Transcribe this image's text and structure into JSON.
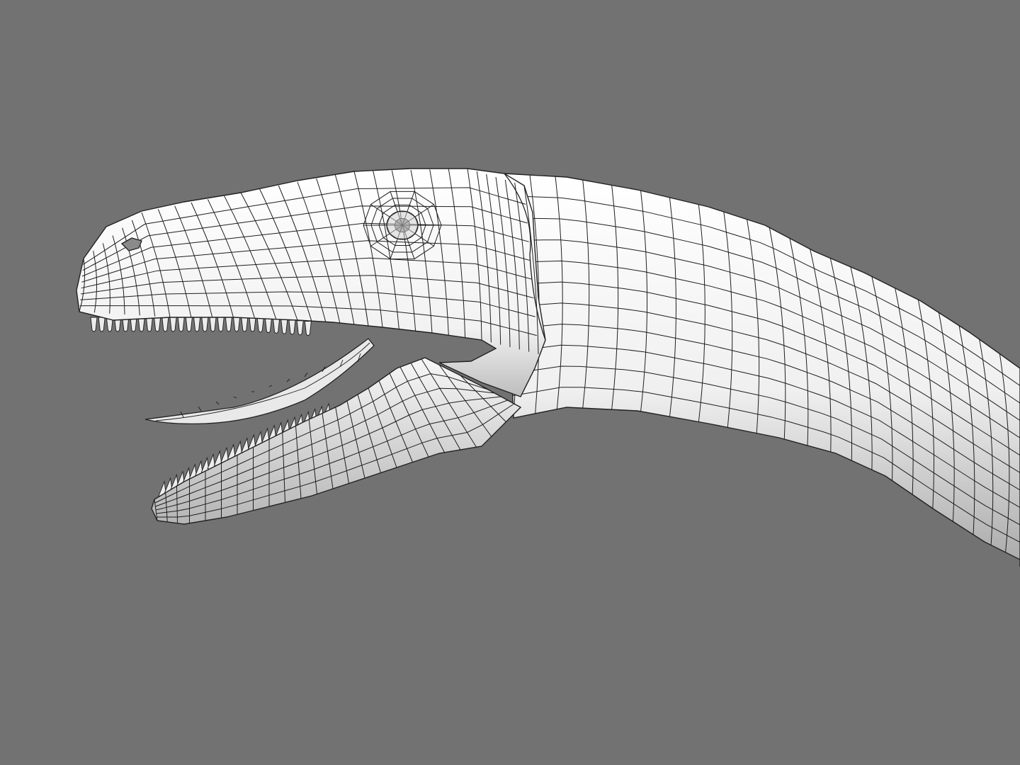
{
  "scene": {
    "background_color": "#727272",
    "mesh_fill_color": "#f4f4f4",
    "wire_color": "#1e1e1e",
    "shading_color": "#b9b9b9",
    "subject": "dinosaur-head-wireframe-model",
    "parts": [
      "upper-jaw",
      "lower-jaw",
      "tongue",
      "eye",
      "nostril",
      "neck",
      "upper-teeth",
      "lower-teeth"
    ]
  }
}
